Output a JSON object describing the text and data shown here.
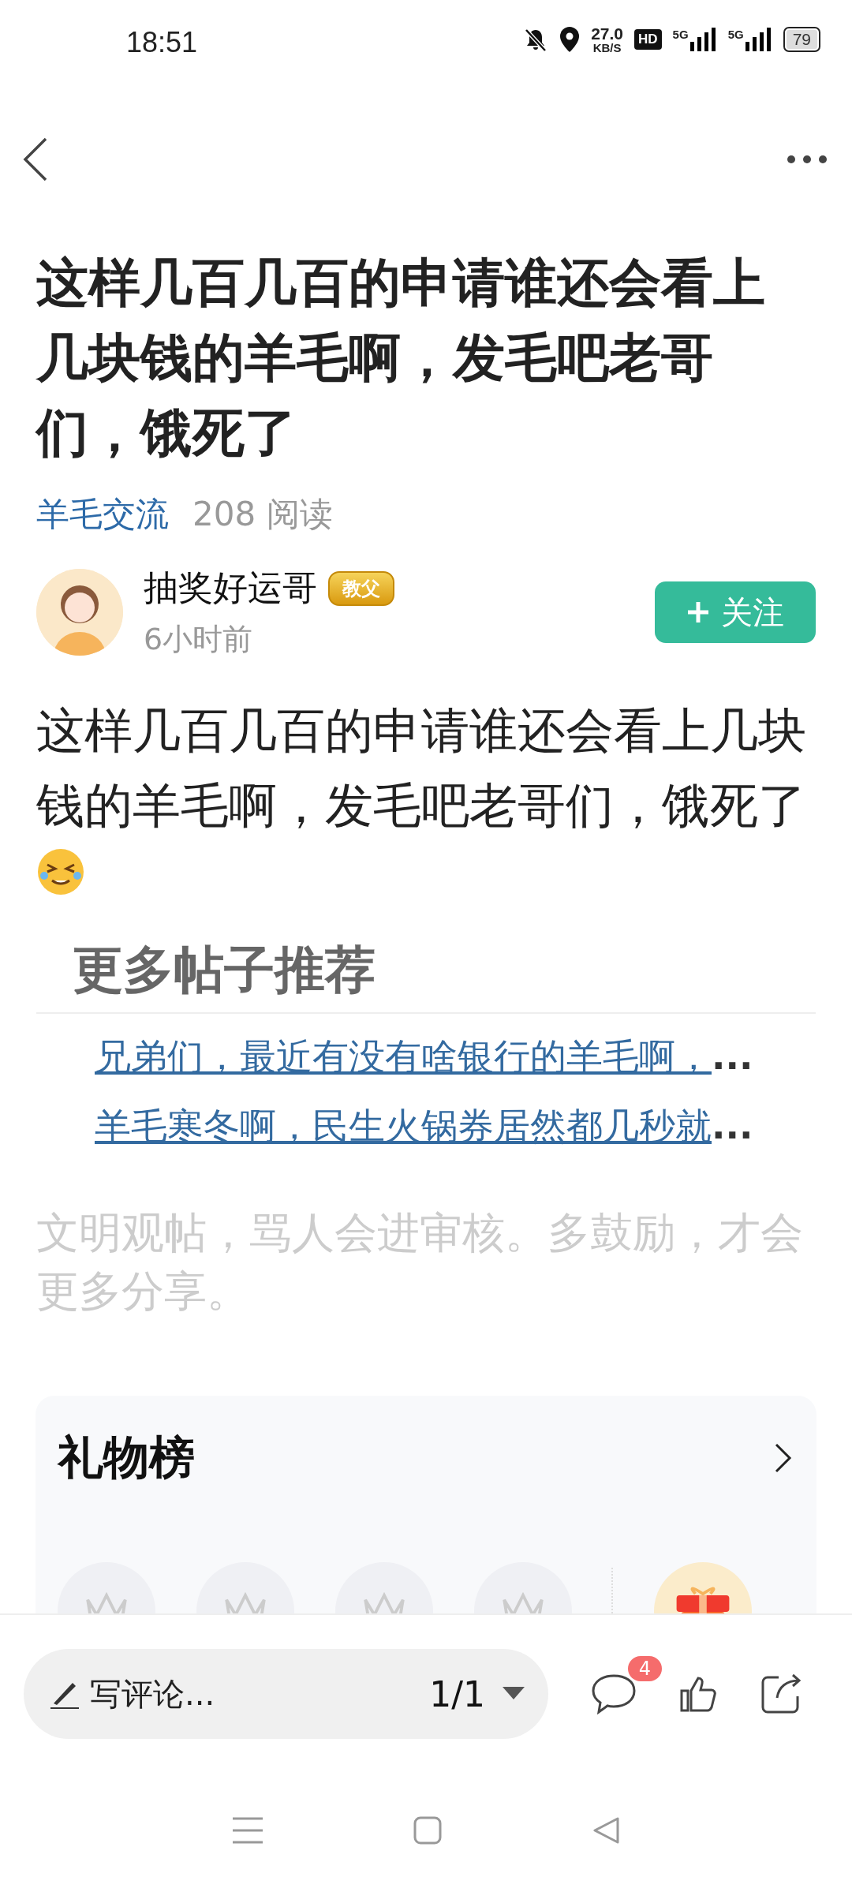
{
  "status_bar": {
    "time": "18:51",
    "speed": "27.0",
    "speed_unit": "KB/S",
    "hd": "HD",
    "sim_1": "5G",
    "sim_2": "5G",
    "battery": "79"
  },
  "post": {
    "title": "这样几百几百的申请谁还会看上几块钱的羊毛啊，发毛吧老哥们，饿死了",
    "category": "羊毛交流",
    "reads": "208 阅读",
    "author": {
      "name": "抽奖好运哥",
      "badge": "教父",
      "time": "6小时前"
    },
    "follow_button": "关注",
    "body": "这样几百几百的申请谁还会看上几块钱的羊毛啊，发毛吧老哥们，饿死了"
  },
  "recommended": {
    "heading": "更多帖子推荐",
    "links": [
      {
        "text": "兄弟们，最近有没有啥银行的羊毛啊，",
        "ellipsis": "..."
      },
      {
        "text": "羊毛寒冬啊，民生火锅券居然都几秒就",
        "ellipsis": "..."
      }
    ]
  },
  "notice": "文明观帖，骂人会进审核。多鼓励，才会更多分享。",
  "gift_ranking": {
    "title": "礼物榜"
  },
  "bottom_bar": {
    "placeholder": "写评论...",
    "page": "1/1",
    "comment_count": "4"
  }
}
